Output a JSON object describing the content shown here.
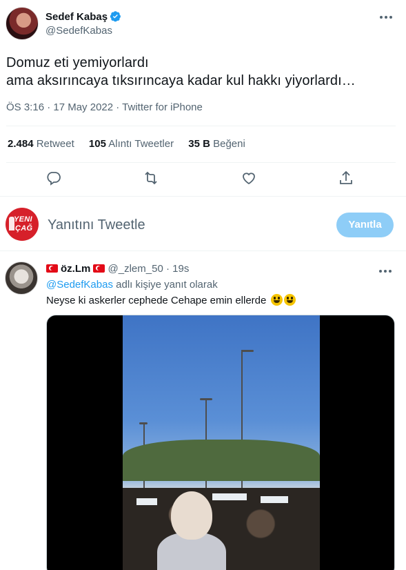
{
  "tweet": {
    "author_name": "Sedef Kabaş",
    "author_handle": "@SedefKabas",
    "text_line1": "Domuz eti yemiyorlardı",
    "text_line2": "ama aksırıncaya tıksırıncaya kadar kul hakkı yiyorlardı…",
    "meta": "ÖS 3:16 · 17 May 2022 · Twitter for iPhone",
    "stats": [
      {
        "count": "2.484",
        "label": "Retweet"
      },
      {
        "count": "105",
        "label": "Alıntı Tweetler"
      },
      {
        "count": "35 B",
        "label": "Beğeni"
      }
    ]
  },
  "actions": [
    "reply-icon",
    "retweet-icon",
    "like-icon",
    "share-icon"
  ],
  "reply_box": {
    "avatar_text_1": "YENI",
    "avatar_text_2": "ÇAĞ",
    "placeholder": "Yanıtını Tweetle",
    "button_label": "Yanıtla"
  },
  "reply": {
    "author_name": "öz.Lm",
    "author_handle": "@_zlem_50",
    "time": "19s",
    "replying_to_handle": "@SedefKabas",
    "replying_to_suffix": "adlı kişiye yanıt olarak",
    "text": "Neyse ki askerler cephede Cehape emin ellerde"
  },
  "colors": {
    "accent": "#1d9bf0",
    "muted": "#536471",
    "button_disabled": "#8ecdf7",
    "divider": "#eff3f4"
  }
}
